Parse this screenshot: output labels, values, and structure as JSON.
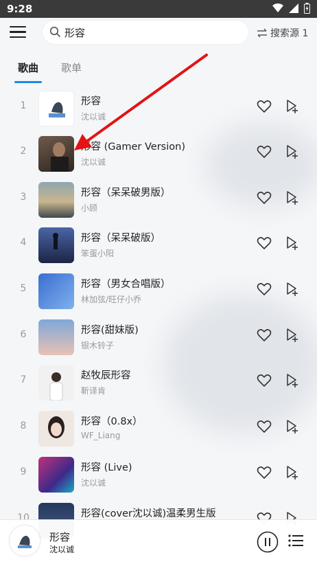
{
  "status_bar": {
    "time": "9:28"
  },
  "search": {
    "query": "形容",
    "source_label": "搜索源 1"
  },
  "tabs": [
    {
      "label": "歌曲",
      "active": true
    },
    {
      "label": "歌单",
      "active": false
    }
  ],
  "songs": [
    {
      "index": "1",
      "title": "形容",
      "artist": "沈以诚"
    },
    {
      "index": "2",
      "title": "形容 (Gamer Version)",
      "artist": "沈以诚"
    },
    {
      "index": "3",
      "title": "形容（呆呆破男版）",
      "artist": "小顾"
    },
    {
      "index": "4",
      "title": "形容（呆呆破版）",
      "artist": "笨蛋小阳"
    },
    {
      "index": "5",
      "title": "形容（男女合唱版）",
      "artist": "林加弦/旺仔小乔"
    },
    {
      "index": "6",
      "title": "形容(甜妹版)",
      "artist": "银木铃子"
    },
    {
      "index": "7",
      "title": "赵牧辰形容",
      "artist": "靳译肯"
    },
    {
      "index": "8",
      "title": "形容（0.8x）",
      "artist": "WF_Liang"
    },
    {
      "index": "9",
      "title": "形容 (Live)",
      "artist": "沈以诚"
    },
    {
      "index": "10",
      "title": "形容(cover沈以诚)温柔男生版",
      "artist": ""
    }
  ],
  "player": {
    "title": "形容",
    "artist": "沈以诚"
  },
  "colors": {
    "accent": "#1e88e5",
    "annotation_arrow": "#e21414"
  }
}
